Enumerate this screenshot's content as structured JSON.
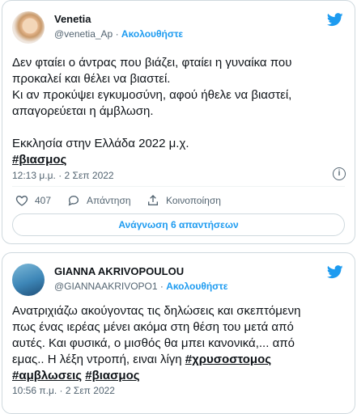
{
  "tweet1": {
    "name": "Venetia",
    "handle": "@venetia_Ap",
    "sep": " · ",
    "follow": "Ακολουθήστε",
    "text": "Δεν φταίει ο άντρας που βιάζει, φταίει η γυναίκα που\nπροκαλεί και θέλει να βιαστεί.\nΚι αν προκύψει εγκυμοσύνη, αφού ήθελε να βιαστεί,\nαπαγορεύεται η άμβλωση.\n\nΕκκλησία στην Ελλάδα 2022 μ.χ.\n",
    "hashtag": "#βιασμος",
    "time": "12:13 μ.μ. · 2 Σεπ 2022",
    "likes": "407",
    "reply_label": "Απάντηση",
    "share_label": "Κοινοποίηση",
    "read_replies": "Ανάγνωση 6 απαντήσεων"
  },
  "tweet2": {
    "name": "GIANNA AKRIVOPOULOU",
    "handle": "@GIANNAAKRIVOPO1",
    "sep": " · ",
    "follow": "Ακολουθήστε",
    "text": "Ανατριχιάζω ακούγοντας τις δηλώσεις και σκεπτόμενη\nπως ένας ιερέας μένει ακόμα στη θέση του μετά από\nαυτές. Και φυσικά, ο μισθός θα μπει κανονικά,... από\nεμας.. Η λέξη ντροπή, ειναι λίγη ",
    "hashtag1": "#χρυσοστομος",
    "newline": "\n",
    "hashtag2": "#αμβλωσεις",
    "space": " ",
    "hashtag3": "#βιασμος",
    "time": "10:56 π.μ. · 2 Σεπ 2022"
  },
  "colors": {
    "accent": "#1d9bf0",
    "muted": "#536471",
    "border": "#cfd9de"
  },
  "icons": [
    "twitter-bird-icon",
    "heart-icon",
    "reply-icon",
    "share-icon",
    "info-icon"
  ]
}
